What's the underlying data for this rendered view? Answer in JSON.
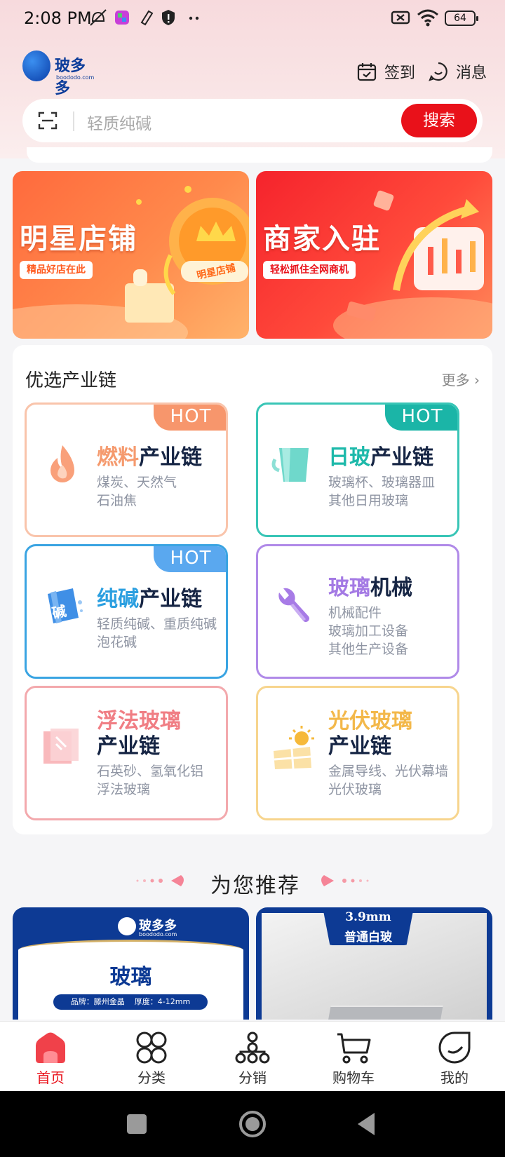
{
  "status_bar": {
    "time": "2:08 PM",
    "battery": "64"
  },
  "header": {
    "logo_text": "玻多多",
    "logo_sub": "boododo.com",
    "checkin_label": "签到",
    "messages_label": "消息"
  },
  "search": {
    "placeholder": "轻质纯碱",
    "button_label": "搜索"
  },
  "banners": [
    {
      "title": "明星店铺",
      "tag": "精品好店在此",
      "badge": "明星店铺"
    },
    {
      "title": "商家入驻",
      "tag": "轻松抓住全网商机"
    }
  ],
  "industry": {
    "title": "优选产业链",
    "more_label": "更多",
    "tiles": [
      {
        "highlight": "燃料",
        "rest": "产业链",
        "sub1": "煤炭、天然气",
        "sub2": "石油焦",
        "hot": "HOT",
        "color": "#f39a6d"
      },
      {
        "highlight": "日玻",
        "rest": "产业链",
        "sub1": "玻璃杯、玻璃器皿",
        "sub2": "其他日用玻璃",
        "hot": "HOT",
        "color": "#1db9aa"
      },
      {
        "highlight": "纯碱",
        "rest": "产业链",
        "sub1": "轻质纯碱、重质纯碱",
        "sub2": "泡花碱",
        "hot": "HOT",
        "color": "#2b9fe0",
        "icon_char": "碱"
      },
      {
        "highlight": "玻璃",
        "rest": "机械",
        "sub1": "机械配件",
        "sub2": "玻璃加工设备",
        "sub3": "其他生产设备",
        "color": "#a47ae4"
      },
      {
        "highlight": "浮法玻璃",
        "line2": "产业链",
        "sub1": "石英砂、氢氧化铝",
        "sub2": "浮法玻璃",
        "color": "#f07e84"
      },
      {
        "highlight": "光伏玻璃",
        "line2": "产业链",
        "sub1": "金属导线、光伏幕墙",
        "sub2": "光伏玻璃",
        "color": "#f3b84a"
      }
    ]
  },
  "recommend": {
    "title": "为您推荐",
    "products": [
      {
        "brand": "玻多多",
        "brand_sub": "boododo.com",
        "name": "玻璃",
        "spec": "品牌：滕州金晶    厚度：4-12mm"
      },
      {
        "badge_line1": "3.9mm",
        "badge_line2": "普通白玻"
      }
    ]
  },
  "tabbar": [
    {
      "label": "首页",
      "icon": "home-icon",
      "active": true
    },
    {
      "label": "分类",
      "icon": "category-icon"
    },
    {
      "label": "分销",
      "icon": "distribution-icon"
    },
    {
      "label": "购物车",
      "icon": "cart-icon"
    },
    {
      "label": "我的",
      "icon": "profile-icon"
    }
  ],
  "colors": {
    "accent": "#e9111a",
    "brand_blue": "#0c3c9a"
  }
}
